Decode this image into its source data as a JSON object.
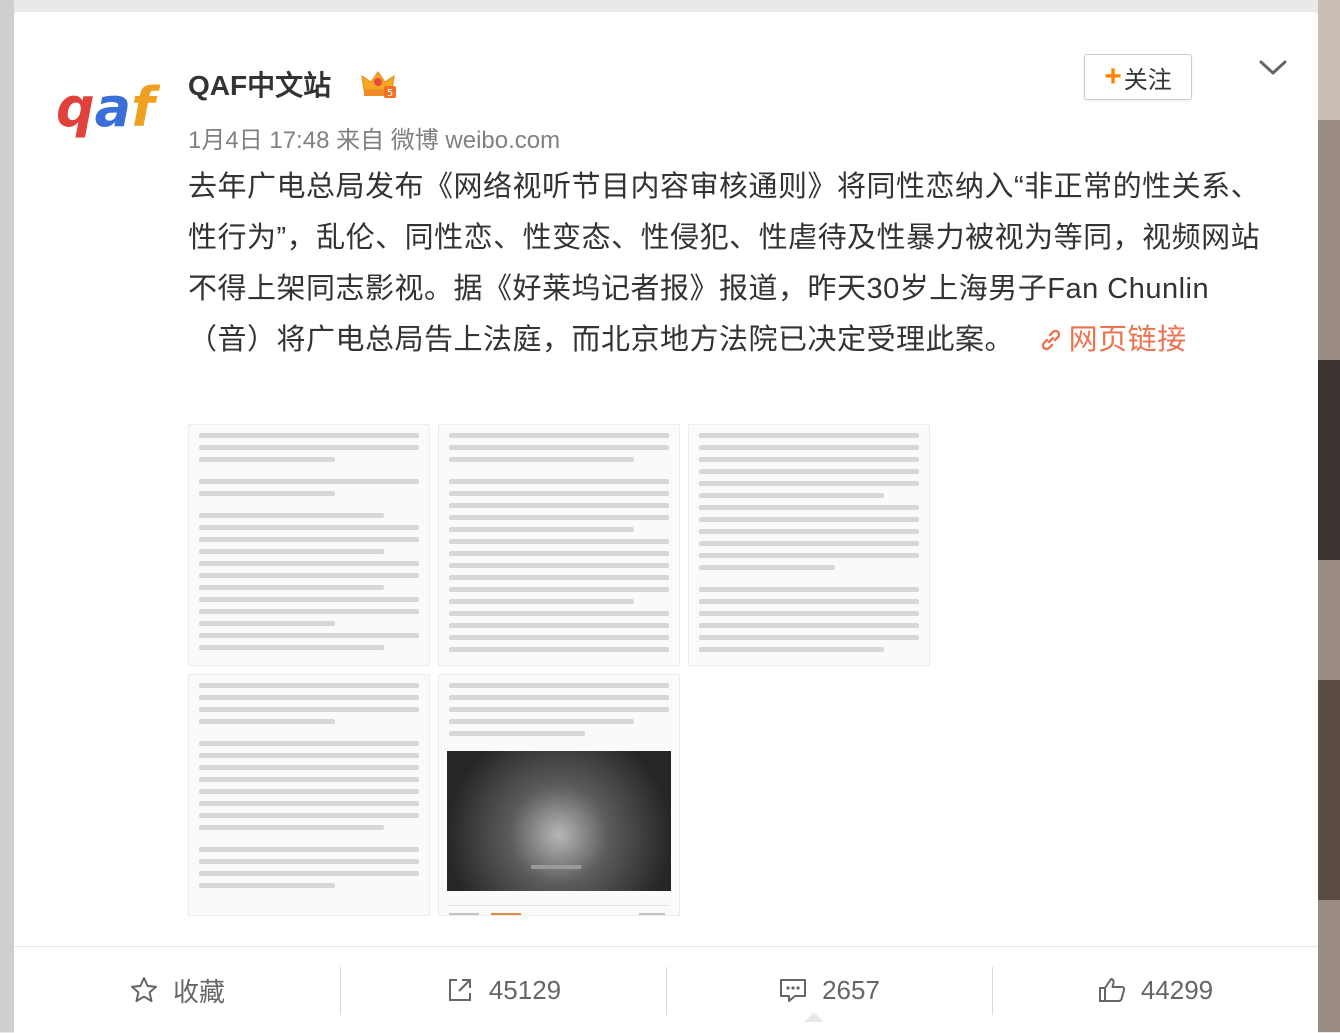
{
  "author": {
    "name": "QAF中文站",
    "avatar_text": "qaf",
    "badge": "crown-vip-icon"
  },
  "meta": "1月4日 17:48 来自 微博 weibo.com",
  "follow": {
    "plus": "+",
    "label": "关注"
  },
  "post": {
    "body": "去年广电总局发布《网络视听节目内容审核通则》将同性恋纳入“非正常的性关系、性行为”，乱伦、同性恋、性变态、性侵犯、性虐待及性暴力被视为等同，视频网站不得上架同志影视。据《好莱坞记者报》报道，昨天30岁上海男子Fan Chunlin（音）将广电总局告上法庭，而北京地方法院已决定受理此案。",
    "link_label": "网页链接"
  },
  "actions": {
    "favorite": "收藏",
    "repost": "45129",
    "comment": "2657",
    "like": "44299"
  },
  "colors": {
    "link": "#eb7350",
    "follow_plus": "#ff8200",
    "text": "#333333",
    "meta": "#808080"
  }
}
